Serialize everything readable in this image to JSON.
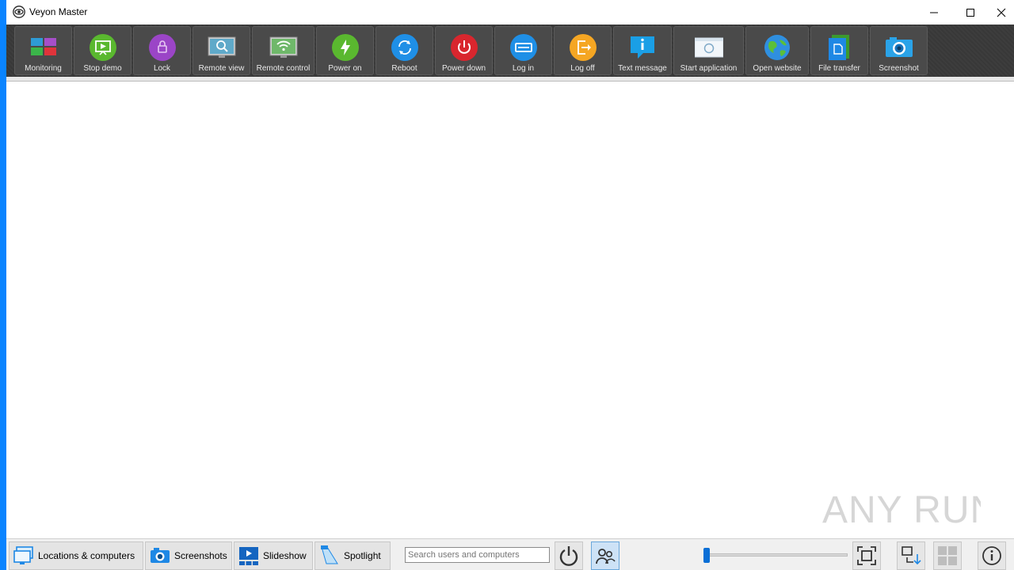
{
  "window": {
    "title": "Veyon Master"
  },
  "toolbar": {
    "buttons": [
      {
        "label": "Monitoring",
        "icon": "monitoring-icon"
      },
      {
        "label": "Stop demo",
        "icon": "demo-icon"
      },
      {
        "label": "Lock",
        "icon": "lock-icon"
      },
      {
        "label": "Remote view",
        "icon": "remote-view-icon"
      },
      {
        "label": "Remote control",
        "icon": "remote-control-icon"
      },
      {
        "label": "Power on",
        "icon": "power-on-icon"
      },
      {
        "label": "Reboot",
        "icon": "reboot-icon"
      },
      {
        "label": "Power down",
        "icon": "power-down-icon"
      },
      {
        "label": "Log in",
        "icon": "log-in-icon"
      },
      {
        "label": "Log off",
        "icon": "log-off-icon"
      },
      {
        "label": "Text message",
        "icon": "text-message-icon"
      },
      {
        "label": "Start application",
        "icon": "start-application-icon"
      },
      {
        "label": "Open website",
        "icon": "open-website-icon"
      },
      {
        "label": "File transfer",
        "icon": "file-transfer-icon"
      },
      {
        "label": "Screenshot",
        "icon": "screenshot-icon"
      }
    ]
  },
  "bottom": {
    "tabs": [
      {
        "label": "Locations & computers"
      },
      {
        "label": "Screenshots"
      },
      {
        "label": "Slideshow"
      },
      {
        "label": "Spotlight"
      }
    ],
    "search_placeholder": "Search users and computers",
    "zoom_level": 0.0
  },
  "watermark": "ANY RUN",
  "colors": {
    "accent": "#0a84ff",
    "toolbar_bg": "#3a3a3a"
  }
}
